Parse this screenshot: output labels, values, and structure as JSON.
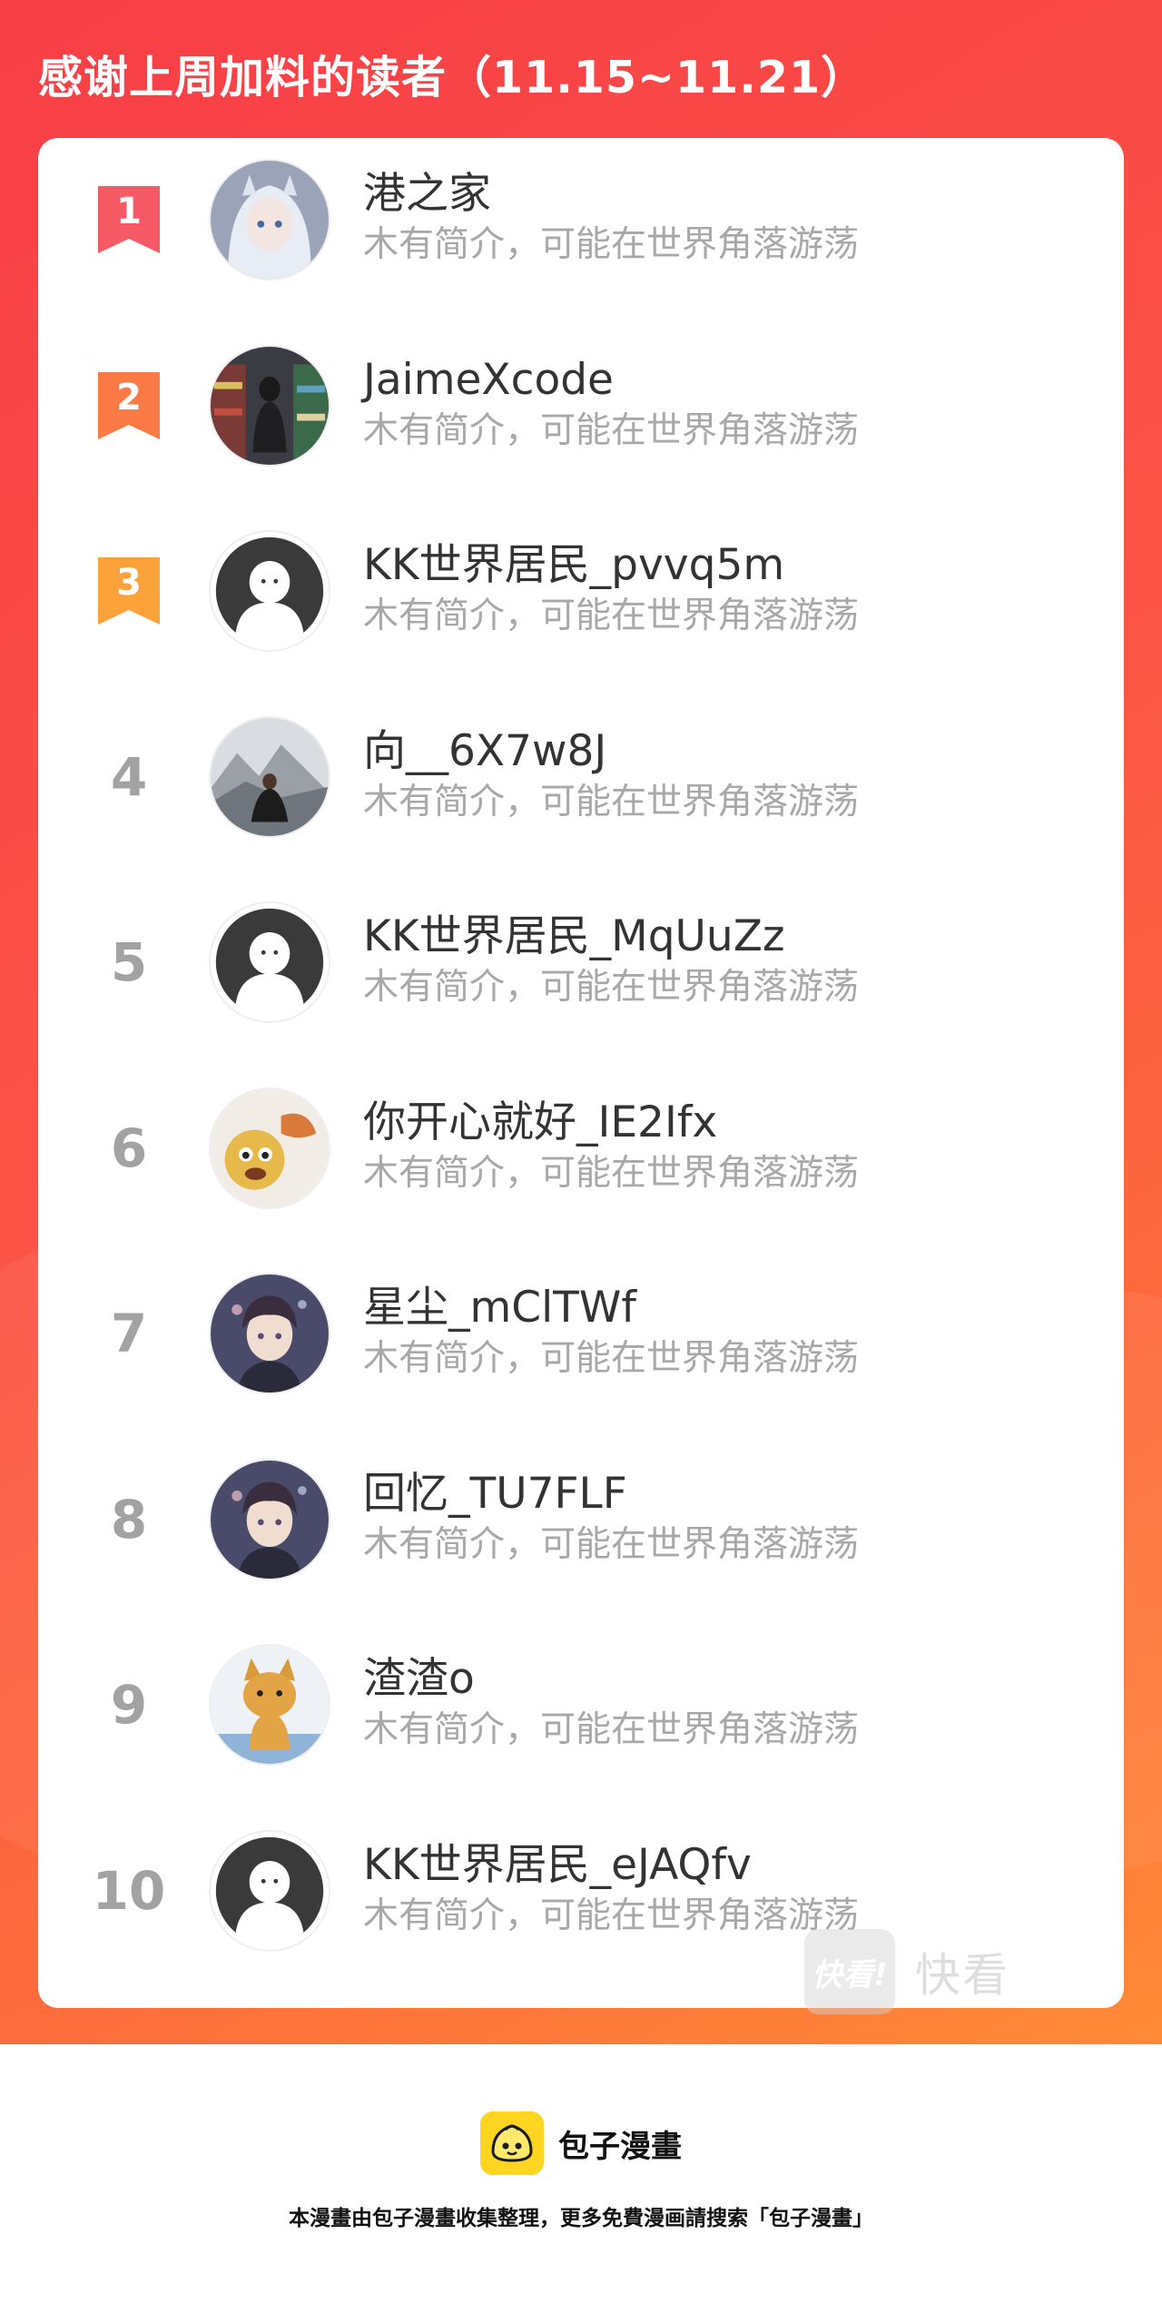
{
  "header": {
    "title": "感谢上周加料的读者（11.15~11.21）"
  },
  "colors": {
    "banner_start": "#f83e47",
    "banner_end": "#ff8a36",
    "medal_1": "#f55a65",
    "medal_2": "#fb7a46",
    "medal_3": "#fca23a",
    "rank_gray": "#a2a2a2",
    "name_text": "#333333",
    "bio_text": "#a8a8a8",
    "brand_yellow": "#ffd51f"
  },
  "leaderboard": {
    "rows": [
      {
        "rank": "1",
        "name": "港之家",
        "bio": "木有简介，可能在世界角落游荡",
        "avatar_icon": "anime-girl-avatar"
      },
      {
        "rank": "2",
        "name": "JaimeXcode",
        "bio": "木有简介，可能在世界角落游荡",
        "avatar_icon": "store-aisle-photo-avatar"
      },
      {
        "rank": "3",
        "name": "KK世界居民_pvvq5m",
        "bio": "木有简介，可能在世界角落游荡",
        "avatar_icon": "default-user-avatar"
      },
      {
        "rank": "4",
        "name": "向__6X7w8J",
        "bio": "木有简介，可能在世界角落游荡",
        "avatar_icon": "mountain-photo-avatar"
      },
      {
        "rank": "5",
        "name": "KK世界居民_MqUuZz",
        "bio": "木有简介，可能在世界角落游荡",
        "avatar_icon": "default-user-avatar"
      },
      {
        "rank": "6",
        "name": "你开心就好_IE2Ifx",
        "bio": "木有简介，可能在世界角落游荡",
        "avatar_icon": "cartoon-dog-avatar"
      },
      {
        "rank": "7",
        "name": "星尘_mClTWf",
        "bio": "木有简介，可能在世界角落游荡",
        "avatar_icon": "anime-boy-avatar"
      },
      {
        "rank": "8",
        "name": "回忆_TU7FLF",
        "bio": "木有简介，可能在世界角落游荡",
        "avatar_icon": "anime-boy-avatar"
      },
      {
        "rank": "9",
        "name": "渣渣o",
        "bio": "木有简介，可能在世界角落游荡",
        "avatar_icon": "shiba-dog-avatar"
      },
      {
        "rank": "10",
        "name": "KK世界居民_eJAQfv",
        "bio": "木有简介，可能在世界角落游荡",
        "avatar_icon": "default-user-avatar"
      }
    ]
  },
  "watermark": {
    "logo_text": "快看!",
    "text": "快看"
  },
  "footer": {
    "brand_name": "包子漫畫",
    "note": "本漫畫由包子漫畫收集整理，更多免費漫画請搜索「包子漫畫」"
  }
}
